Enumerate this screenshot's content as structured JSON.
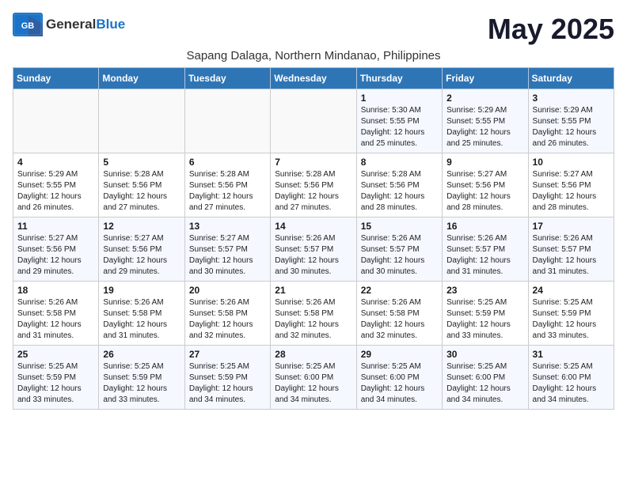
{
  "header": {
    "logo_general": "General",
    "logo_blue": "Blue",
    "month_title": "May 2025",
    "subtitle": "Sapang Dalaga, Northern Mindanao, Philippines"
  },
  "weekdays": [
    "Sunday",
    "Monday",
    "Tuesday",
    "Wednesday",
    "Thursday",
    "Friday",
    "Saturday"
  ],
  "weeks": [
    [
      {
        "day": "",
        "info": ""
      },
      {
        "day": "",
        "info": ""
      },
      {
        "day": "",
        "info": ""
      },
      {
        "day": "",
        "info": ""
      },
      {
        "day": "1",
        "info": "Sunrise: 5:30 AM\nSunset: 5:55 PM\nDaylight: 12 hours and 25 minutes."
      },
      {
        "day": "2",
        "info": "Sunrise: 5:29 AM\nSunset: 5:55 PM\nDaylight: 12 hours and 25 minutes."
      },
      {
        "day": "3",
        "info": "Sunrise: 5:29 AM\nSunset: 5:55 PM\nDaylight: 12 hours and 26 minutes."
      }
    ],
    [
      {
        "day": "4",
        "info": "Sunrise: 5:29 AM\nSunset: 5:55 PM\nDaylight: 12 hours and 26 minutes."
      },
      {
        "day": "5",
        "info": "Sunrise: 5:28 AM\nSunset: 5:56 PM\nDaylight: 12 hours and 27 minutes."
      },
      {
        "day": "6",
        "info": "Sunrise: 5:28 AM\nSunset: 5:56 PM\nDaylight: 12 hours and 27 minutes."
      },
      {
        "day": "7",
        "info": "Sunrise: 5:28 AM\nSunset: 5:56 PM\nDaylight: 12 hours and 27 minutes."
      },
      {
        "day": "8",
        "info": "Sunrise: 5:28 AM\nSunset: 5:56 PM\nDaylight: 12 hours and 28 minutes."
      },
      {
        "day": "9",
        "info": "Sunrise: 5:27 AM\nSunset: 5:56 PM\nDaylight: 12 hours and 28 minutes."
      },
      {
        "day": "10",
        "info": "Sunrise: 5:27 AM\nSunset: 5:56 PM\nDaylight: 12 hours and 28 minutes."
      }
    ],
    [
      {
        "day": "11",
        "info": "Sunrise: 5:27 AM\nSunset: 5:56 PM\nDaylight: 12 hours and 29 minutes."
      },
      {
        "day": "12",
        "info": "Sunrise: 5:27 AM\nSunset: 5:56 PM\nDaylight: 12 hours and 29 minutes."
      },
      {
        "day": "13",
        "info": "Sunrise: 5:27 AM\nSunset: 5:57 PM\nDaylight: 12 hours and 30 minutes."
      },
      {
        "day": "14",
        "info": "Sunrise: 5:26 AM\nSunset: 5:57 PM\nDaylight: 12 hours and 30 minutes."
      },
      {
        "day": "15",
        "info": "Sunrise: 5:26 AM\nSunset: 5:57 PM\nDaylight: 12 hours and 30 minutes."
      },
      {
        "day": "16",
        "info": "Sunrise: 5:26 AM\nSunset: 5:57 PM\nDaylight: 12 hours and 31 minutes."
      },
      {
        "day": "17",
        "info": "Sunrise: 5:26 AM\nSunset: 5:57 PM\nDaylight: 12 hours and 31 minutes."
      }
    ],
    [
      {
        "day": "18",
        "info": "Sunrise: 5:26 AM\nSunset: 5:58 PM\nDaylight: 12 hours and 31 minutes."
      },
      {
        "day": "19",
        "info": "Sunrise: 5:26 AM\nSunset: 5:58 PM\nDaylight: 12 hours and 31 minutes."
      },
      {
        "day": "20",
        "info": "Sunrise: 5:26 AM\nSunset: 5:58 PM\nDaylight: 12 hours and 32 minutes."
      },
      {
        "day": "21",
        "info": "Sunrise: 5:26 AM\nSunset: 5:58 PM\nDaylight: 12 hours and 32 minutes."
      },
      {
        "day": "22",
        "info": "Sunrise: 5:26 AM\nSunset: 5:58 PM\nDaylight: 12 hours and 32 minutes."
      },
      {
        "day": "23",
        "info": "Sunrise: 5:25 AM\nSunset: 5:59 PM\nDaylight: 12 hours and 33 minutes."
      },
      {
        "day": "24",
        "info": "Sunrise: 5:25 AM\nSunset: 5:59 PM\nDaylight: 12 hours and 33 minutes."
      }
    ],
    [
      {
        "day": "25",
        "info": "Sunrise: 5:25 AM\nSunset: 5:59 PM\nDaylight: 12 hours and 33 minutes."
      },
      {
        "day": "26",
        "info": "Sunrise: 5:25 AM\nSunset: 5:59 PM\nDaylight: 12 hours and 33 minutes."
      },
      {
        "day": "27",
        "info": "Sunrise: 5:25 AM\nSunset: 5:59 PM\nDaylight: 12 hours and 34 minutes."
      },
      {
        "day": "28",
        "info": "Sunrise: 5:25 AM\nSunset: 6:00 PM\nDaylight: 12 hours and 34 minutes."
      },
      {
        "day": "29",
        "info": "Sunrise: 5:25 AM\nSunset: 6:00 PM\nDaylight: 12 hours and 34 minutes."
      },
      {
        "day": "30",
        "info": "Sunrise: 5:25 AM\nSunset: 6:00 PM\nDaylight: 12 hours and 34 minutes."
      },
      {
        "day": "31",
        "info": "Sunrise: 5:25 AM\nSunset: 6:00 PM\nDaylight: 12 hours and 34 minutes."
      }
    ]
  ]
}
